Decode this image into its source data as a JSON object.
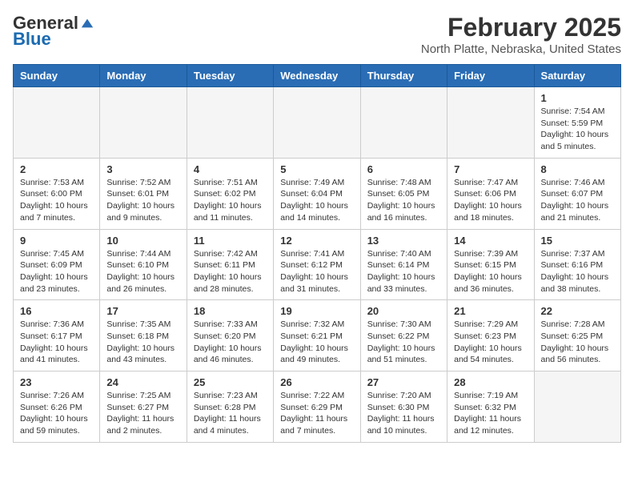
{
  "header": {
    "logo_general": "General",
    "logo_blue": "Blue",
    "month_title": "February 2025",
    "location": "North Platte, Nebraska, United States"
  },
  "days_of_week": [
    "Sunday",
    "Monday",
    "Tuesday",
    "Wednesday",
    "Thursday",
    "Friday",
    "Saturday"
  ],
  "weeks": [
    [
      {
        "day": "",
        "info": ""
      },
      {
        "day": "",
        "info": ""
      },
      {
        "day": "",
        "info": ""
      },
      {
        "day": "",
        "info": ""
      },
      {
        "day": "",
        "info": ""
      },
      {
        "day": "",
        "info": ""
      },
      {
        "day": "1",
        "info": "Sunrise: 7:54 AM\nSunset: 5:59 PM\nDaylight: 10 hours and 5 minutes."
      }
    ],
    [
      {
        "day": "2",
        "info": "Sunrise: 7:53 AM\nSunset: 6:00 PM\nDaylight: 10 hours and 7 minutes."
      },
      {
        "day": "3",
        "info": "Sunrise: 7:52 AM\nSunset: 6:01 PM\nDaylight: 10 hours and 9 minutes."
      },
      {
        "day": "4",
        "info": "Sunrise: 7:51 AM\nSunset: 6:02 PM\nDaylight: 10 hours and 11 minutes."
      },
      {
        "day": "5",
        "info": "Sunrise: 7:49 AM\nSunset: 6:04 PM\nDaylight: 10 hours and 14 minutes."
      },
      {
        "day": "6",
        "info": "Sunrise: 7:48 AM\nSunset: 6:05 PM\nDaylight: 10 hours and 16 minutes."
      },
      {
        "day": "7",
        "info": "Sunrise: 7:47 AM\nSunset: 6:06 PM\nDaylight: 10 hours and 18 minutes."
      },
      {
        "day": "8",
        "info": "Sunrise: 7:46 AM\nSunset: 6:07 PM\nDaylight: 10 hours and 21 minutes."
      }
    ],
    [
      {
        "day": "9",
        "info": "Sunrise: 7:45 AM\nSunset: 6:09 PM\nDaylight: 10 hours and 23 minutes."
      },
      {
        "day": "10",
        "info": "Sunrise: 7:44 AM\nSunset: 6:10 PM\nDaylight: 10 hours and 26 minutes."
      },
      {
        "day": "11",
        "info": "Sunrise: 7:42 AM\nSunset: 6:11 PM\nDaylight: 10 hours and 28 minutes."
      },
      {
        "day": "12",
        "info": "Sunrise: 7:41 AM\nSunset: 6:12 PM\nDaylight: 10 hours and 31 minutes."
      },
      {
        "day": "13",
        "info": "Sunrise: 7:40 AM\nSunset: 6:14 PM\nDaylight: 10 hours and 33 minutes."
      },
      {
        "day": "14",
        "info": "Sunrise: 7:39 AM\nSunset: 6:15 PM\nDaylight: 10 hours and 36 minutes."
      },
      {
        "day": "15",
        "info": "Sunrise: 7:37 AM\nSunset: 6:16 PM\nDaylight: 10 hours and 38 minutes."
      }
    ],
    [
      {
        "day": "16",
        "info": "Sunrise: 7:36 AM\nSunset: 6:17 PM\nDaylight: 10 hours and 41 minutes."
      },
      {
        "day": "17",
        "info": "Sunrise: 7:35 AM\nSunset: 6:18 PM\nDaylight: 10 hours and 43 minutes."
      },
      {
        "day": "18",
        "info": "Sunrise: 7:33 AM\nSunset: 6:20 PM\nDaylight: 10 hours and 46 minutes."
      },
      {
        "day": "19",
        "info": "Sunrise: 7:32 AM\nSunset: 6:21 PM\nDaylight: 10 hours and 49 minutes."
      },
      {
        "day": "20",
        "info": "Sunrise: 7:30 AM\nSunset: 6:22 PM\nDaylight: 10 hours and 51 minutes."
      },
      {
        "day": "21",
        "info": "Sunrise: 7:29 AM\nSunset: 6:23 PM\nDaylight: 10 hours and 54 minutes."
      },
      {
        "day": "22",
        "info": "Sunrise: 7:28 AM\nSunset: 6:25 PM\nDaylight: 10 hours and 56 minutes."
      }
    ],
    [
      {
        "day": "23",
        "info": "Sunrise: 7:26 AM\nSunset: 6:26 PM\nDaylight: 10 hours and 59 minutes."
      },
      {
        "day": "24",
        "info": "Sunrise: 7:25 AM\nSunset: 6:27 PM\nDaylight: 11 hours and 2 minutes."
      },
      {
        "day": "25",
        "info": "Sunrise: 7:23 AM\nSunset: 6:28 PM\nDaylight: 11 hours and 4 minutes."
      },
      {
        "day": "26",
        "info": "Sunrise: 7:22 AM\nSunset: 6:29 PM\nDaylight: 11 hours and 7 minutes."
      },
      {
        "day": "27",
        "info": "Sunrise: 7:20 AM\nSunset: 6:30 PM\nDaylight: 11 hours and 10 minutes."
      },
      {
        "day": "28",
        "info": "Sunrise: 7:19 AM\nSunset: 6:32 PM\nDaylight: 11 hours and 12 minutes."
      },
      {
        "day": "",
        "info": ""
      }
    ]
  ]
}
